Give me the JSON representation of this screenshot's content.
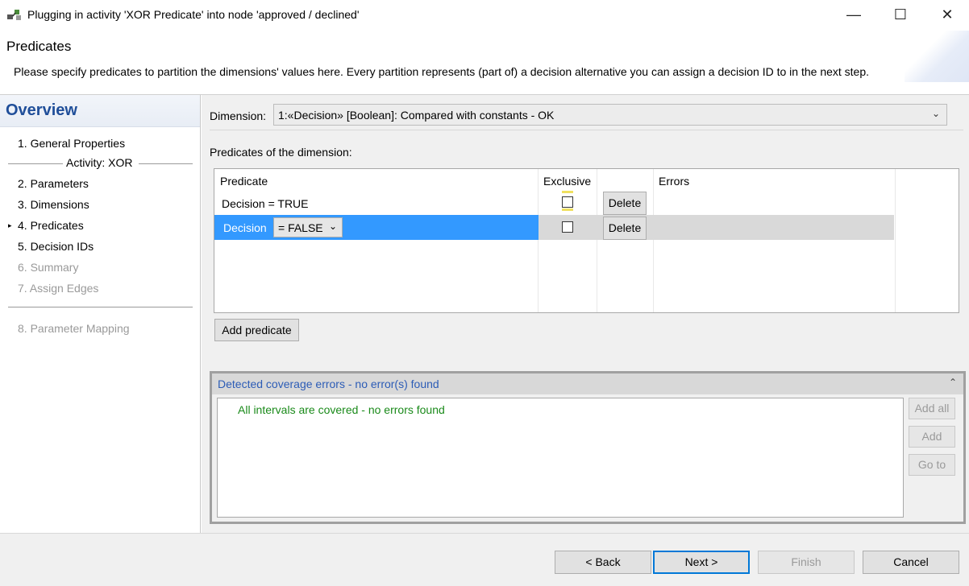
{
  "window": {
    "title": "Plugging in activity 'XOR Predicate' into node 'approved / declined'",
    "app_icon": "plugin-activity-icon",
    "controls": {
      "minimize": "—",
      "maximize": "☐",
      "close": "✕"
    }
  },
  "header": {
    "title": "Predicates",
    "description": "Please specify predicates to partition the dimensions' values here. Every partition represents (part of) a decision alternative you can assign a decision ID to in the next step."
  },
  "sidebar": {
    "title": "Overview",
    "activity_label": "Activity: XOR",
    "items": [
      {
        "label": "1. General Properties",
        "enabled": true
      },
      {
        "label": "2. Parameters",
        "enabled": true
      },
      {
        "label": "3. Dimensions",
        "enabled": true
      },
      {
        "label": "4. Predicates",
        "enabled": true,
        "current": true
      },
      {
        "label": "5. Decision IDs",
        "enabled": true
      },
      {
        "label": "6. Summary",
        "enabled": false
      },
      {
        "label": "7. Assign Edges",
        "enabled": false
      },
      {
        "label": "8. Parameter Mapping",
        "enabled": false
      }
    ],
    "current_marker": "▸"
  },
  "main": {
    "dimension_label": "Dimension:",
    "dimension_value": "1:«Decision» [Boolean]: Compared with constants  -  OK",
    "predicates_label": "Predicates of the dimension:",
    "table": {
      "headers": {
        "predicate": "Predicate",
        "exclusive": "Exclusive",
        "errors": "Errors"
      },
      "rows": [
        {
          "predicate": "Decision = TRUE",
          "exclusive": false,
          "action": "Delete",
          "errors": ""
        },
        {
          "dimension": "Decision",
          "operator": "= FALSE",
          "exclusive": false,
          "action": "Delete",
          "errors": "",
          "selected": true
        }
      ]
    },
    "add_predicate": "Add predicate",
    "coverage": {
      "title": "Detected coverage errors - no error(s) found",
      "message": "All intervals are covered - no errors found",
      "buttons": {
        "add_all": "Add all",
        "add": "Add",
        "go_to": "Go to"
      }
    }
  },
  "footer": {
    "back": "< Back",
    "next": "Next >",
    "finish": "Finish",
    "cancel": "Cancel"
  },
  "colors": {
    "selection": "#3399ff",
    "overview_title": "#1f4e99",
    "coverage_title": "#2c5cb6",
    "success_text": "#1a8a1a",
    "default_button_border": "#0078d7"
  }
}
